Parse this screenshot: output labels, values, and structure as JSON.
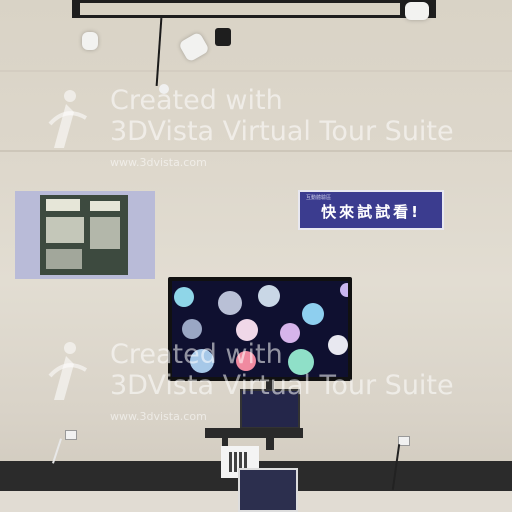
{
  "watermark": {
    "line1": "Created with",
    "line2": "3DVista Virtual Tour Suite",
    "url": "www.3dvista.com"
  },
  "sign": {
    "small_text": "互動體驗區",
    "main_text": "快來試試看!"
  }
}
